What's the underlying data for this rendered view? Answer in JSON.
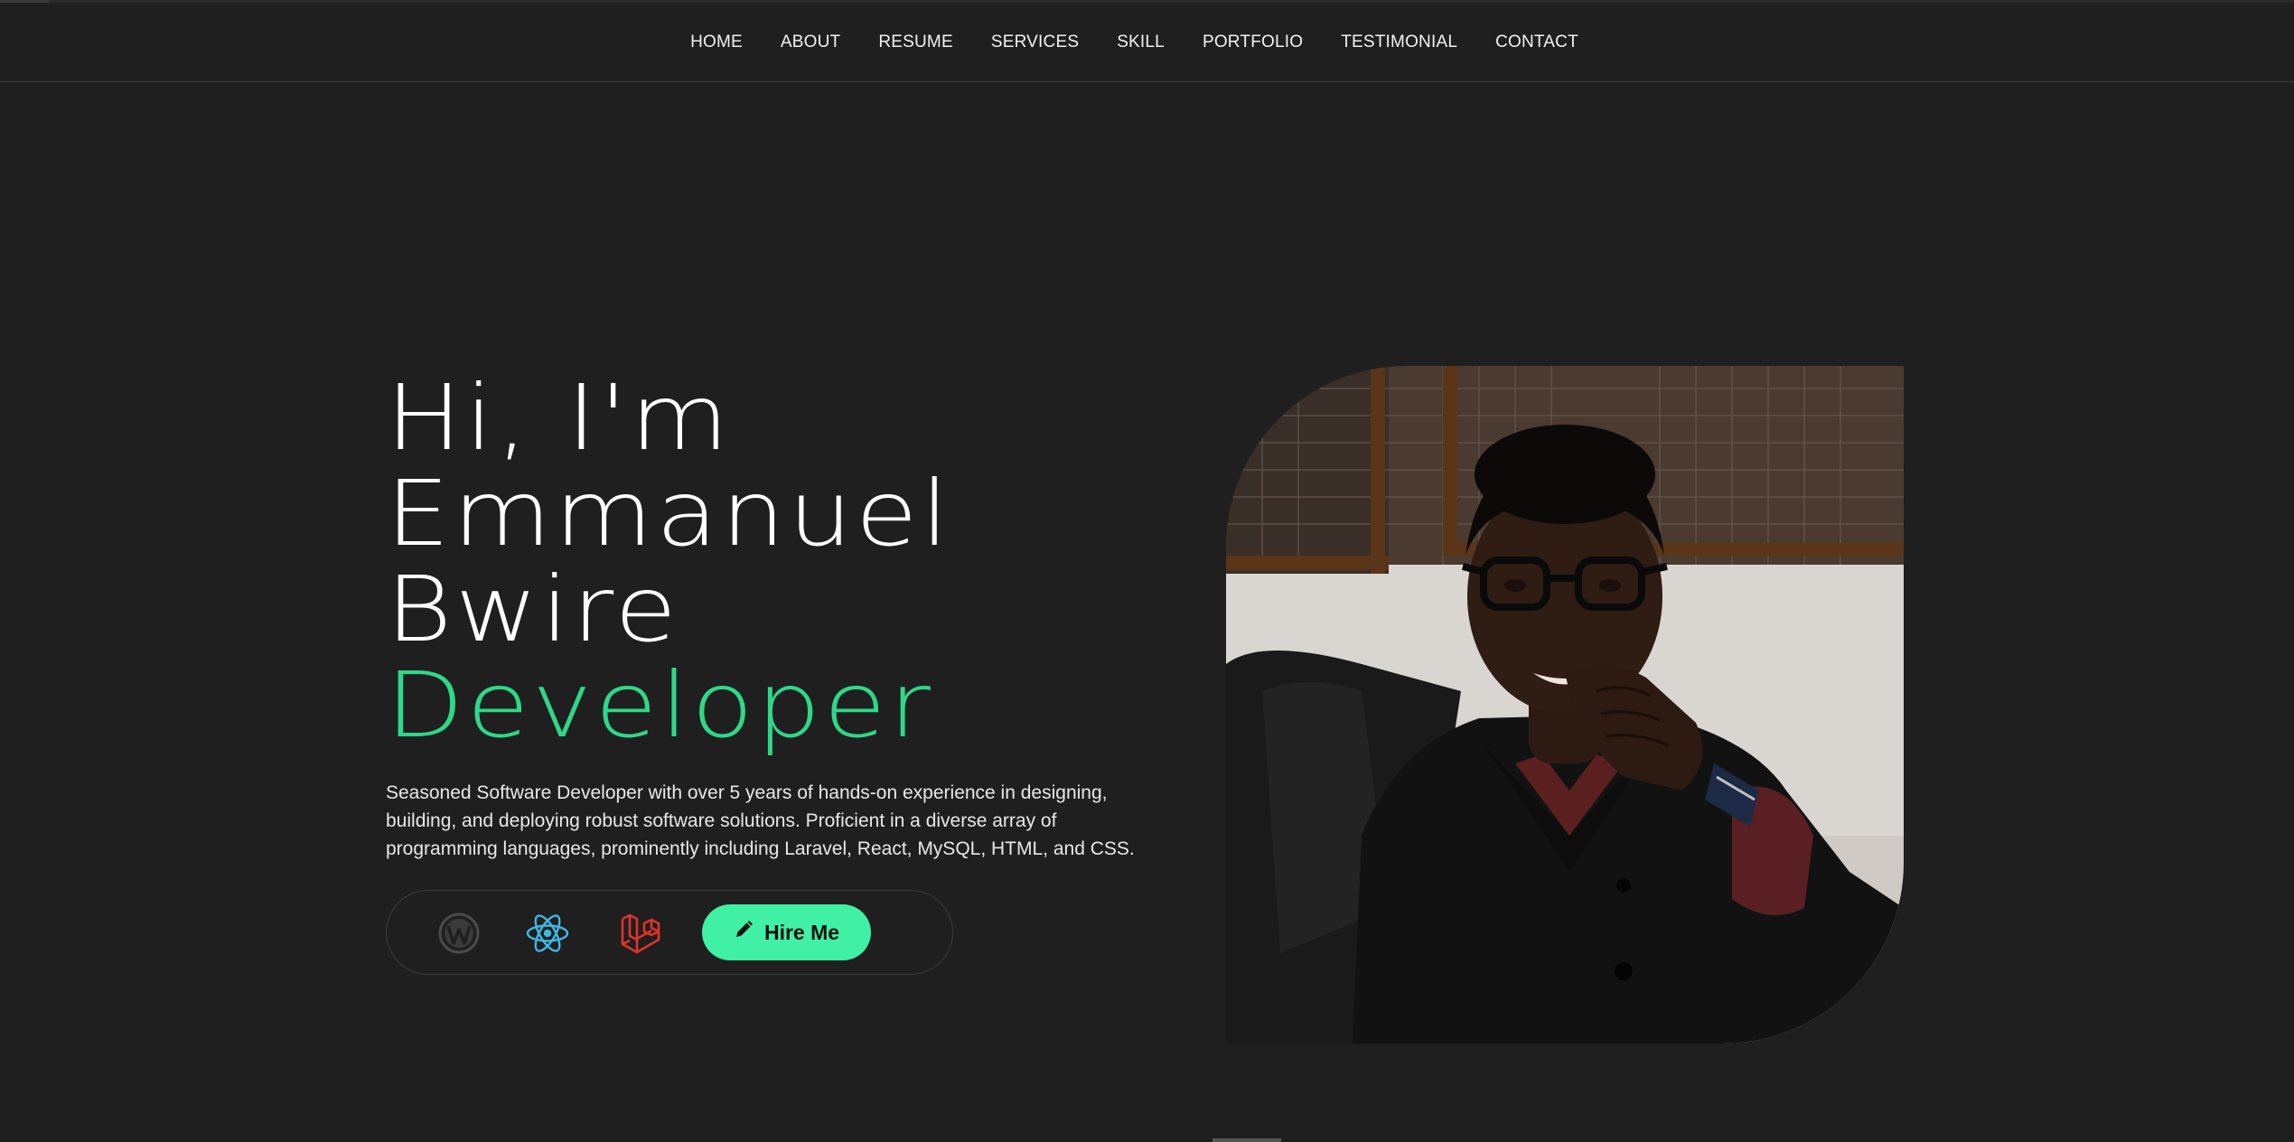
{
  "nav": {
    "items": [
      "HOME",
      "ABOUT",
      "RESUME",
      "SERVICES",
      "SKILL",
      "PORTFOLIO",
      "TESTIMONIAL",
      "CONTACT"
    ]
  },
  "hero": {
    "greeting": "Hi, I'm",
    "first_name": "Emmanuel",
    "last_name": "Bwire",
    "role": "Developer",
    "description": "Seasoned Software Developer with over 5 years of hands-on experience in designing, building, and deploying robust software solutions. Proficient in a diverse array of programming languages, prominently including Laravel, React, MySQL, HTML, and CSS.",
    "hire_label": "Hire Me",
    "icons": [
      "wordpress-icon",
      "react-icon",
      "laravel-icon",
      "pencil-icon"
    ]
  },
  "colors": {
    "background": "#1f1f1f",
    "accent": "#2ed889",
    "button": "#3ff0a5",
    "react": "#3fb8e0",
    "laravel": "#e0342a"
  }
}
